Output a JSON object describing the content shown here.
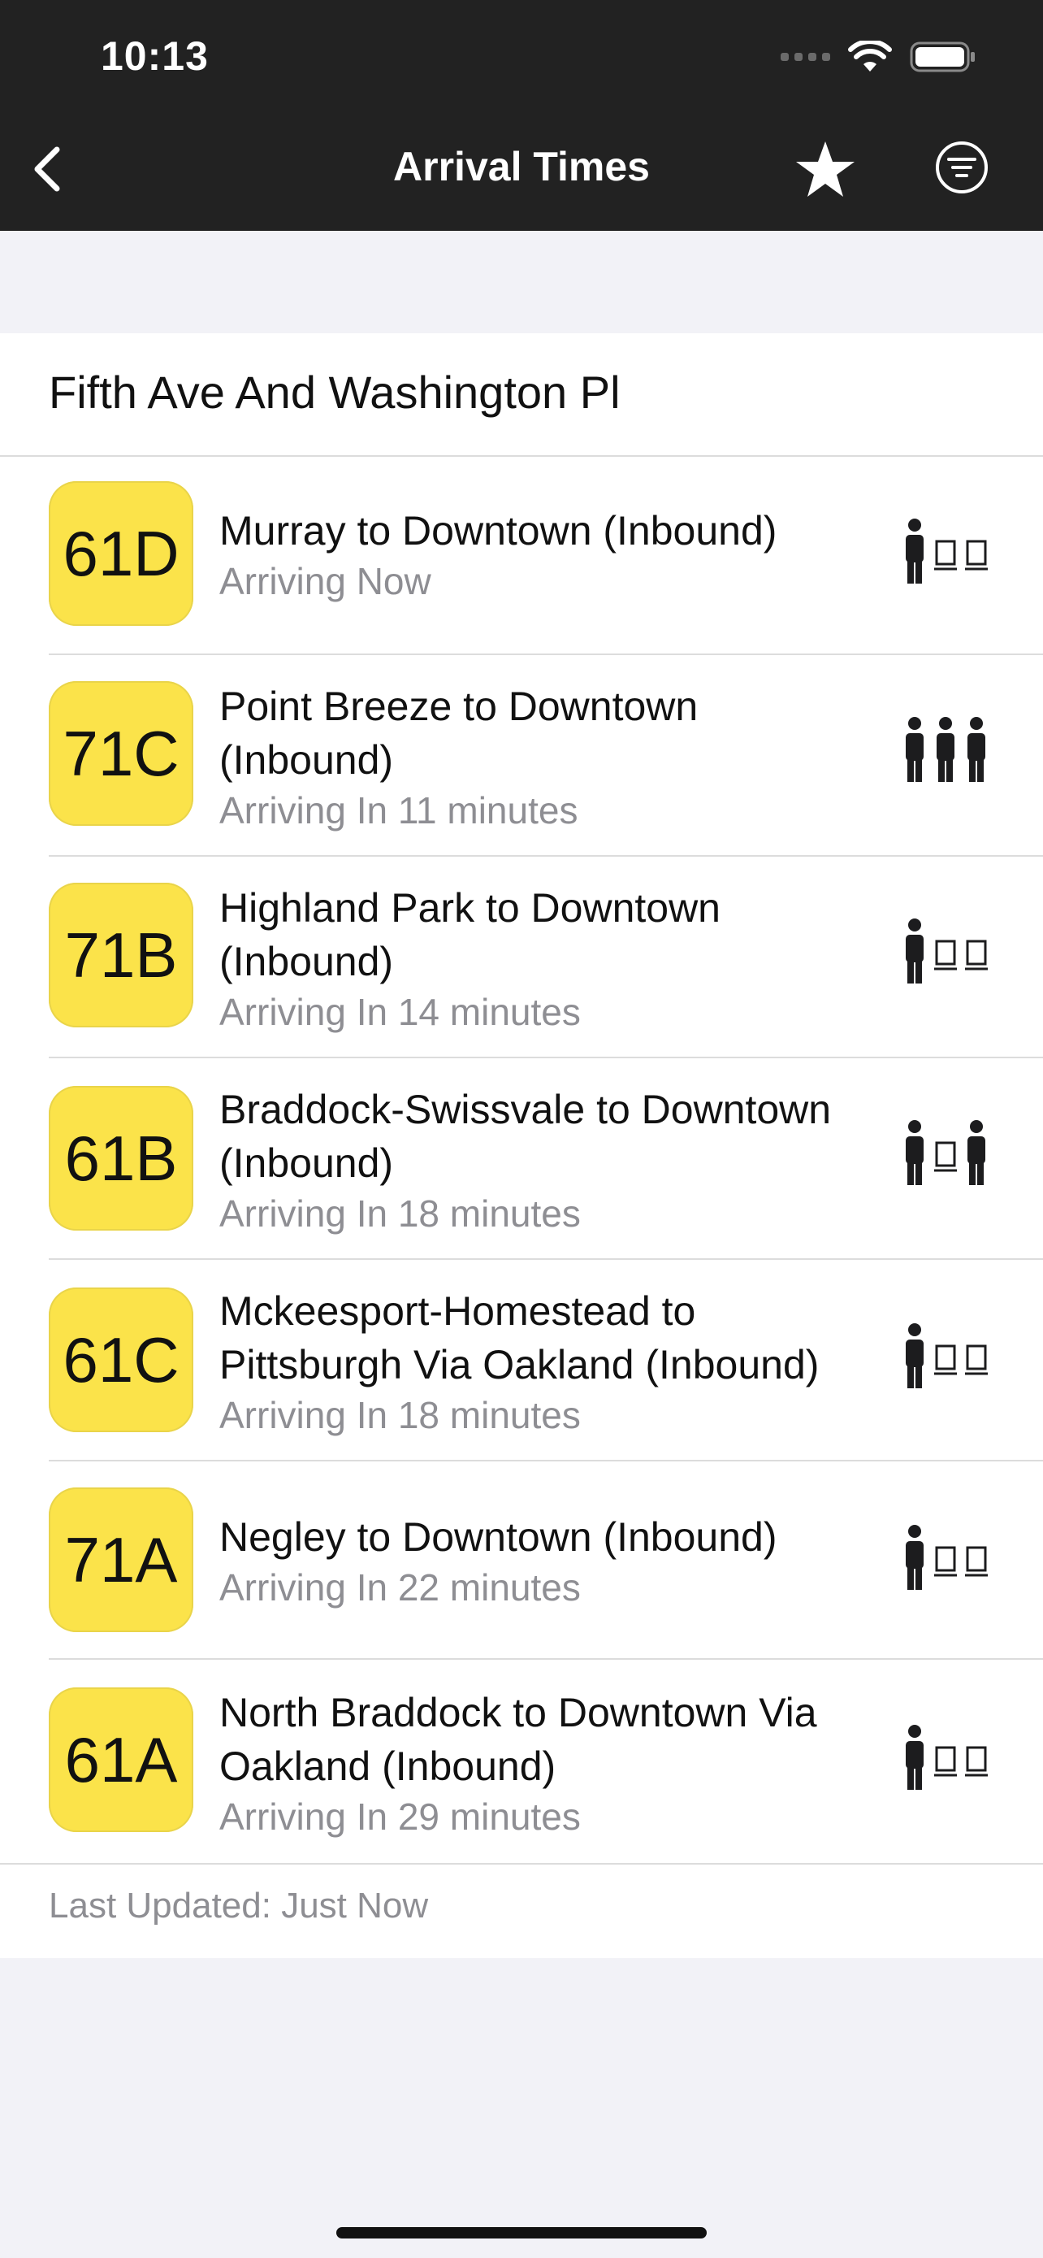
{
  "status_bar": {
    "time": "10:13"
  },
  "nav": {
    "title": "Arrival Times"
  },
  "stop": {
    "name": "Fifth Ave And Washington Pl"
  },
  "arrivals": [
    {
      "route": "61D",
      "name": "Murray to Downtown (Inbound)",
      "arrival": "Arriving Now",
      "occupancy": [
        "person",
        "seat",
        "seat"
      ]
    },
    {
      "route": "71C",
      "name": "Point Breeze to Downtown (Inbound)",
      "arrival": "Arriving In 11 minutes",
      "occupancy": [
        "person",
        "person",
        "person"
      ]
    },
    {
      "route": "71B",
      "name": "Highland Park to Downtown (Inbound)",
      "arrival": "Arriving In 14 minutes",
      "occupancy": [
        "person",
        "seat",
        "seat"
      ]
    },
    {
      "route": "61B",
      "name": "Braddock-Swissvale to Downtown (Inbound)",
      "arrival": "Arriving In 18 minutes",
      "occupancy": [
        "person",
        "seat",
        "person"
      ]
    },
    {
      "route": "61C",
      "name": "Mckeesport-Homestead to Pittsburgh Via Oakland (Inbound)",
      "arrival": "Arriving In 18 minutes",
      "occupancy": [
        "person",
        "seat",
        "seat"
      ]
    },
    {
      "route": "71A",
      "name": "Negley to Downtown (Inbound)",
      "arrival": "Arriving In 22 minutes",
      "occupancy": [
        "person",
        "seat",
        "seat"
      ]
    },
    {
      "route": "61A",
      "name": "North Braddock to Downtown Via Oakland (Inbound)",
      "arrival": "Arriving In 29 minutes",
      "occupancy": [
        "person",
        "seat",
        "seat"
      ]
    }
  ],
  "footer": {
    "last_updated": "Last Updated: Just Now"
  },
  "colors": {
    "header_bg": "#222222",
    "badge_bg": "#fbe34a",
    "secondary_text": "#8e8e93",
    "page_bg": "#f2f2f7"
  },
  "icons": {
    "back": "chevron-left-icon",
    "favorite": "star-icon",
    "filter": "filter-icon",
    "occupancy": "occupancy-icon"
  }
}
